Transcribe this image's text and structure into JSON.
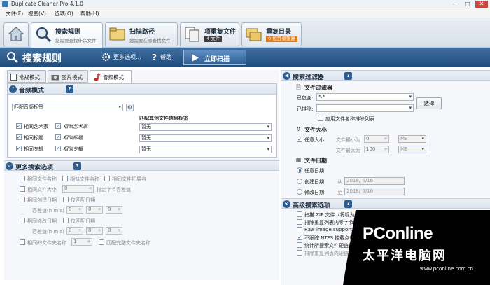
{
  "window": {
    "title": "Duplicate Cleaner Pro 4.1.0"
  },
  "menu": [
    "文件(F)",
    "视图(V)",
    "选项(O)",
    "帮助(H)"
  ],
  "ribbon": {
    "tabs": [
      {
        "label": "搜索规则",
        "sub": "您需要查找什么文件"
      },
      {
        "label": "扫描路径",
        "sub": "您需要在哪查找文件"
      },
      {
        "label": "项重复文件",
        "badge": "4 文件"
      },
      {
        "label": "重复目录",
        "badge": "0 如目录重复"
      }
    ]
  },
  "section": {
    "title": "搜索规则",
    "more": "更多选项...",
    "help": "帮助",
    "scan": "立即扫描"
  },
  "modes": [
    "常规模式",
    "图片模式",
    "音频模式"
  ],
  "audio": {
    "title": "音频模式",
    "match_select": "匹配音频标签",
    "match_other_label": "匹配其他文件信息标签",
    "rows": [
      {
        "a": "相同艺术家",
        "b": "相似艺术家",
        "select": "暂无"
      },
      {
        "a": "相同标题",
        "b": "相似标题",
        "select": "暂无"
      },
      {
        "a": "相同专辑",
        "b": "相似专辑",
        "select": "暂无"
      }
    ]
  },
  "more_options": {
    "title": "更多搜索选项",
    "row1": [
      "相同文件名称",
      "相似文件名称",
      "相同文件拓展名"
    ],
    "size_label": "相同文件大小",
    "size_value": "0",
    "size_hint": "指定字节容差值",
    "created_label": "相同创建日期",
    "created_only": "仅匹配日期",
    "tolerance_label": "容差值(h m s)",
    "modified_label": "相同修改日期",
    "modified_only": "仅匹配日期",
    "folder_label": "相同的文件夹名称",
    "folder_value": "1",
    "folder_hint": "匹配完整文件夹名称",
    "zero": "0"
  },
  "filter": {
    "title": "搜索过滤器",
    "file_filter": "文件过滤器",
    "include_label": "已包含:",
    "include_value": "*.*",
    "exclude_label": "已排除:",
    "select_button": "选择",
    "apply_names": "应用文件名称排除列表",
    "size_title": "文件大小",
    "any_size": "任意大小",
    "min_label": "文件最小为",
    "max_label": "文件最大为",
    "min_value": "0",
    "max_value": "100",
    "unit": "MB",
    "date_title": "文件日期",
    "any_date": "任意日期",
    "created": "创建日期",
    "modified": "修改日期",
    "from": "从",
    "to": "至",
    "date_value": "2018/ 6/16"
  },
  "advanced": {
    "title": "高级搜索选项",
    "items": [
      "扫描 ZIP 文件（将视为目录）",
      "排除重复列表内零字节文件",
      "Raw image support",
      "不跟踪 NTFS 挂载点以及其",
      "统计所搜索文件硬链接数量",
      "排除重复列表内硬链接文件"
    ]
  },
  "watermark": {
    "brand": "PConline",
    "tagline": "太平洋电脑网",
    "url": "www.pconline.com.cn"
  },
  "colors": {
    "header": "#2a5888",
    "accent": "#2d5d90"
  }
}
